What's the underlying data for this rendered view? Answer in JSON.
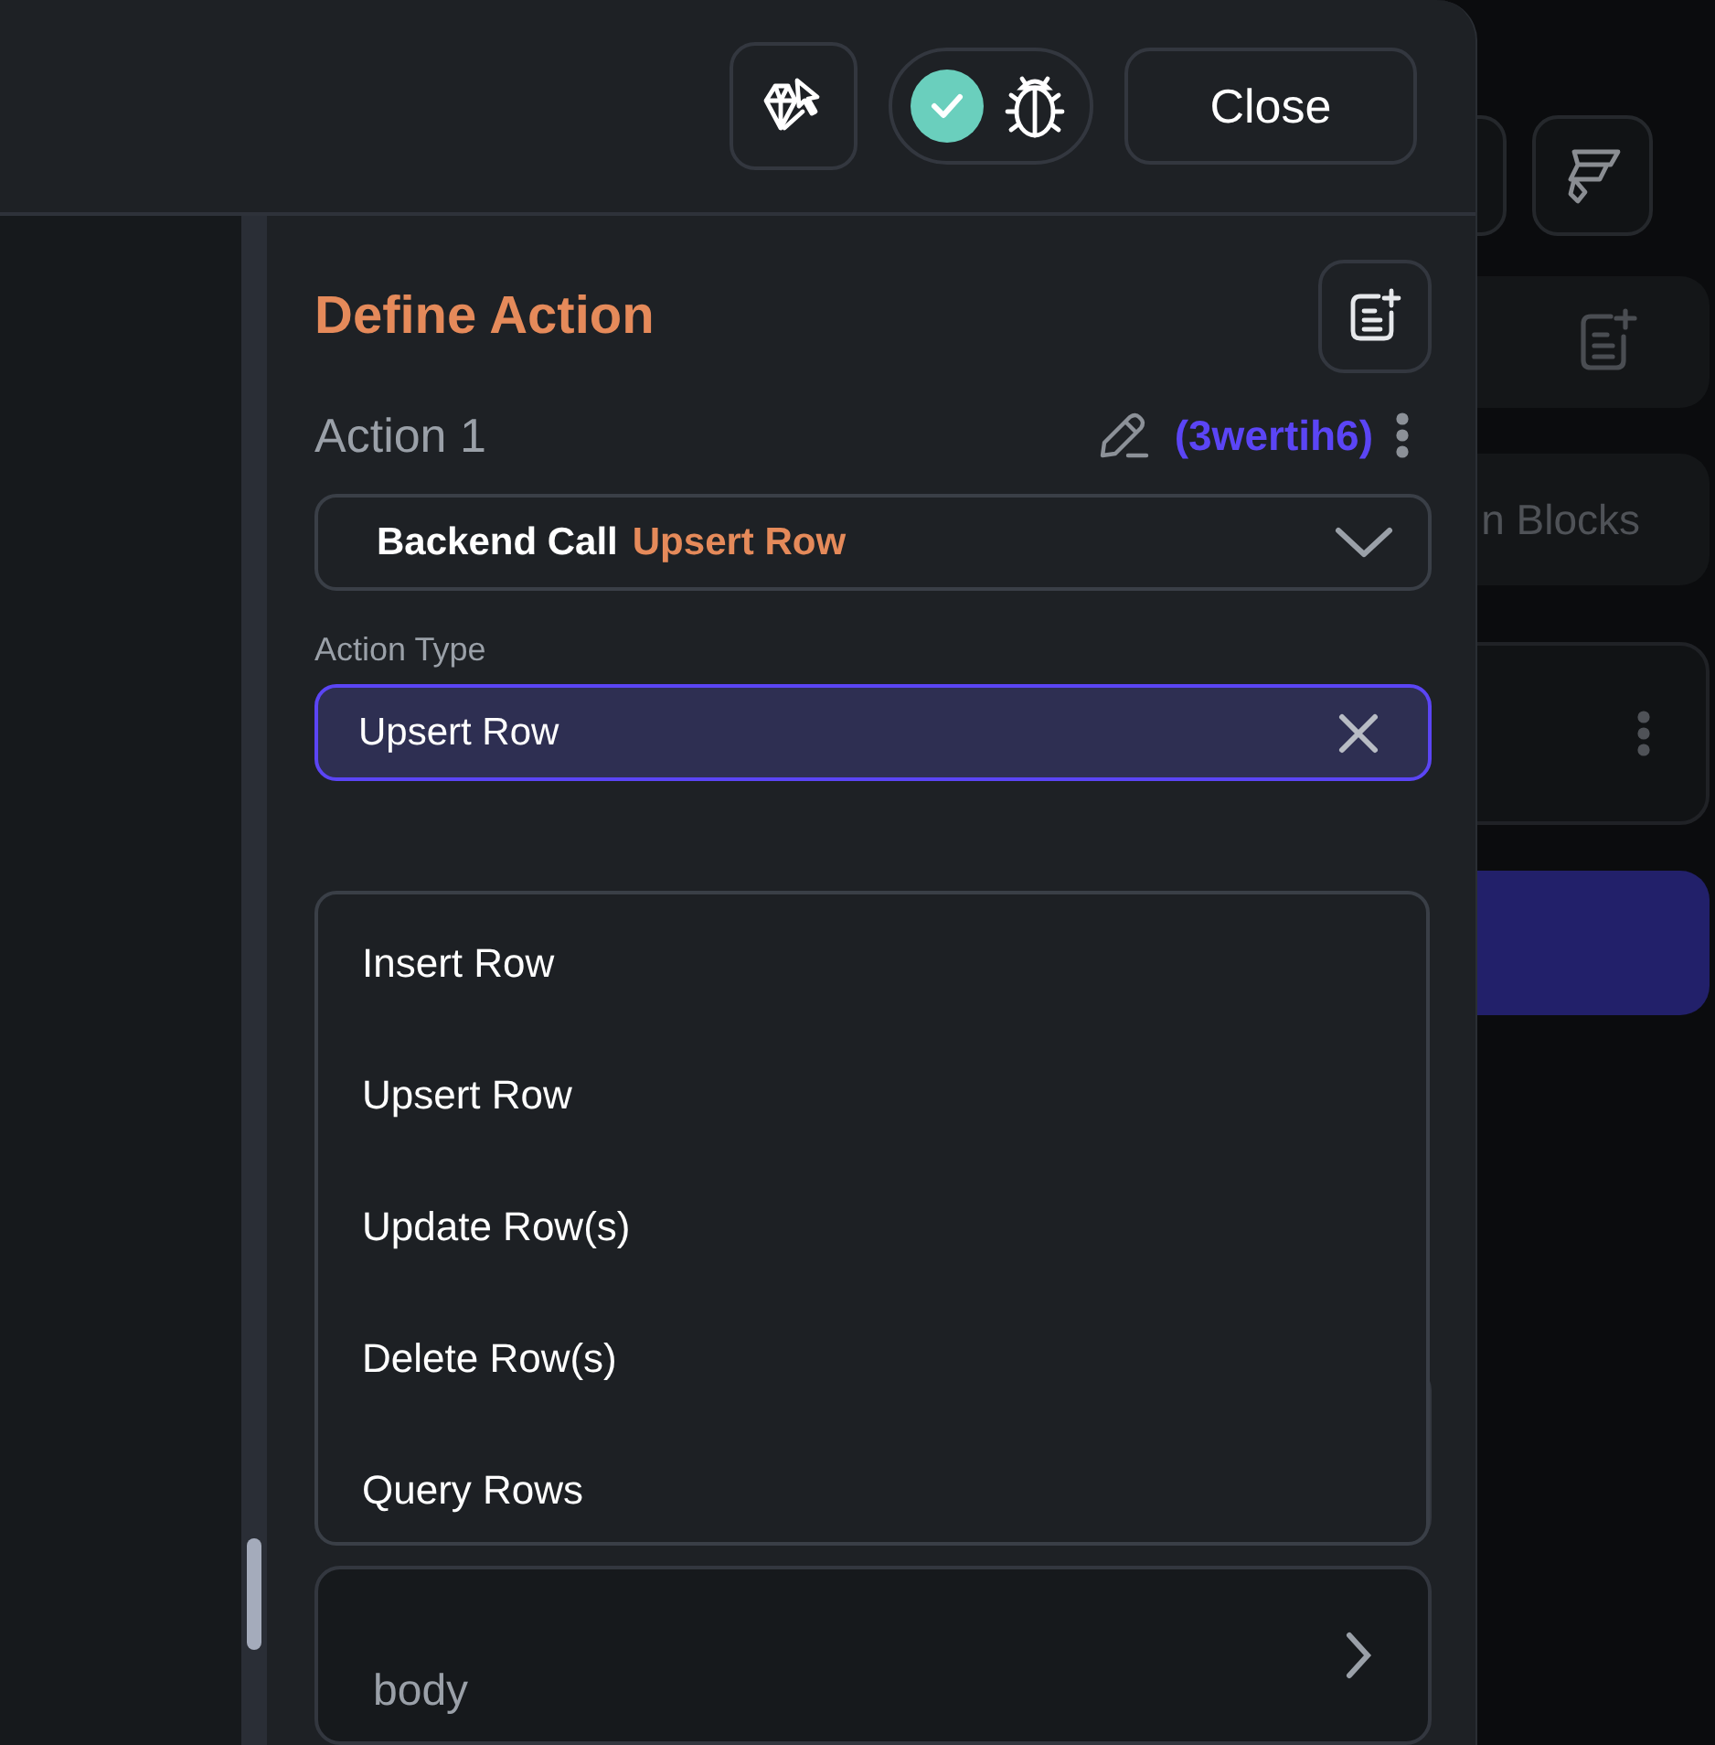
{
  "toolbar": {
    "debug_toggle": {
      "on": true
    },
    "close_button": "Close"
  },
  "panel": {
    "title": "Define Action",
    "action": {
      "name": "Action 1",
      "id": "(3wertih6)",
      "call_type": "Backend Call",
      "call_value": "Upsert Row"
    },
    "action_type": {
      "label": "Action Type",
      "value": "Upsert Row"
    },
    "dropdown": [
      "Insert Row",
      "Upsert Row",
      "Update Row(s)",
      "Delete Row(s)",
      "Query Rows"
    ],
    "fields": [
      {
        "label": "body"
      }
    ]
  },
  "background_panel": {
    "tab_label": "n Blocks"
  }
}
